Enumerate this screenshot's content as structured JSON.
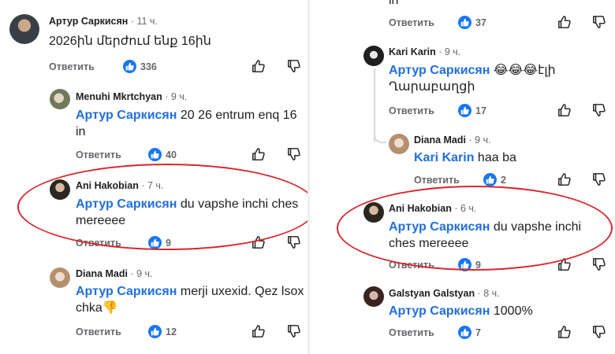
{
  "left": {
    "c1": {
      "author": "Артур Саркисян",
      "time": "11 ч.",
      "text": "2026ին մերժում ենք 16ին",
      "reply": "Ответить",
      "likes": "336"
    },
    "c2": {
      "author": "Menuhi Mkrtchyan",
      "time": "9 ч.",
      "mention": "Артур Саркисян",
      "text": "20 26 entrum enq 16 in",
      "reply": "Ответить",
      "likes": "40"
    },
    "c3": {
      "author": "Ani Hakobian",
      "time": "7 ч.",
      "mention": "Артур Саркисян",
      "text": "du vapshe inchi ches mereeee",
      "reply": "Ответить",
      "likes": "9"
    },
    "c4": {
      "author": "Diana Madi",
      "time": "9 ч.",
      "mention": "Артур Саркисян",
      "text": "merji uxexid. Qez lsox chka",
      "emoji": "👎",
      "reply": "Ответить",
      "likes": "12"
    }
  },
  "right": {
    "top": {
      "text": "in",
      "reply": "Ответить",
      "likes": "37"
    },
    "c1": {
      "author": "Kari Karin",
      "time": "9 ч.",
      "mention": "Артур Саркисян",
      "emoji": "😂😂😂",
      "text1": "էլի",
      "text2": "Ղարաբաղցի",
      "reply": "Ответить",
      "likes": "17"
    },
    "c2": {
      "author": "Diana Madi",
      "time": "9 ч.",
      "mention": "Kari Karin",
      "text": "haa ba",
      "reply": "Ответить",
      "likes": "2"
    },
    "c3": {
      "author": "Ani Hakobian",
      "time": "6 ч.",
      "mention": "Артур Саркисян",
      "text": "du vapshe inchi ches mereeee",
      "reply": "Ответить",
      "likes": "9"
    },
    "c4": {
      "author": "Galstyan Galstyan",
      "time": "8 ч.",
      "mention": "Артур Саркисян",
      "text": "1000%",
      "reply": "Ответить",
      "likes": "7"
    }
  },
  "colors": {
    "mention": "#216fdb",
    "like": "#1877f2",
    "highlight": "#d9262c"
  }
}
